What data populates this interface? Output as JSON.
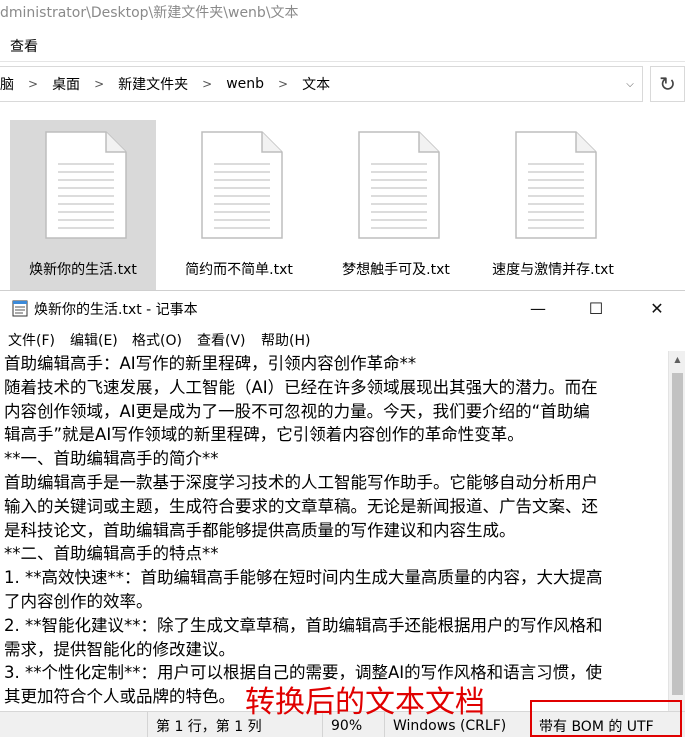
{
  "explorer": {
    "title_path": "dministrator\\Desktop\\新建文件夹\\wenb\\文本",
    "ribbon_tab": "查看",
    "breadcrumbs": [
      "脑",
      "桌面",
      "新建文件夹",
      "wenb",
      "文本"
    ],
    "files": [
      {
        "name": "焕新你的生活.txt",
        "selected": true
      },
      {
        "name": "简约而不简单.txt",
        "selected": false
      },
      {
        "name": "梦想触手可及.txt",
        "selected": false
      },
      {
        "name": "速度与激情并存.txt",
        "selected": false
      }
    ]
  },
  "notepad": {
    "title": "焕新你的生活.txt - 记事本",
    "menu": [
      "文件(F)",
      "编辑(E)",
      "格式(O)",
      "查看(V)",
      "帮助(H)"
    ],
    "lines": [
      "首助编辑高手：AI写作的新里程碑，引领内容创作革命**",
      "随着技术的飞速发展，人工智能（AI）已经在许多领域展现出其强大的潜力。而在",
      "内容创作领域，AI更是成为了一股不可忽视的力量。今天，我们要介绍的“首助编",
      "辑高手”就是AI写作领域的新里程碑，它引领着内容创作的革命性变革。",
      "**一、首助编辑高手的简介**",
      "首助编辑高手是一款基于深度学习技术的人工智能写作助手。它能够自动分析用户",
      "输入的关键词或主题，生成符合要求的文章草稿。无论是新闻报道、广告文案、还",
      "是科技论文，首助编辑高手都能够提供高质量的写作建议和内容生成。",
      "**二、首助编辑高手的特点**",
      "1. **高效快速**：首助编辑高手能够在短时间内生成大量高质量的内容，大大提高",
      "了内容创作的效率。",
      "2. **智能化建议**：除了生成文章草稿，首助编辑高手还能根据用户的写作风格和",
      "需求，提供智能化的修改建议。",
      "3. **个性化定制**：用户可以根据自己的需要，调整AI的写作风格和语言习惯，使",
      "其更加符合个人或品牌的特色。"
    ],
    "status": {
      "position": "第 1 行，第 1 列",
      "zoom": "90%",
      "line_ending": "Windows (CRLF)",
      "encoding": "带有 BOM 的 UTF"
    }
  },
  "overlay_caption": "转换后的文本文档",
  "colors": {
    "annotation_red": "#e00000",
    "selected_bg": "#d9d9d9"
  }
}
